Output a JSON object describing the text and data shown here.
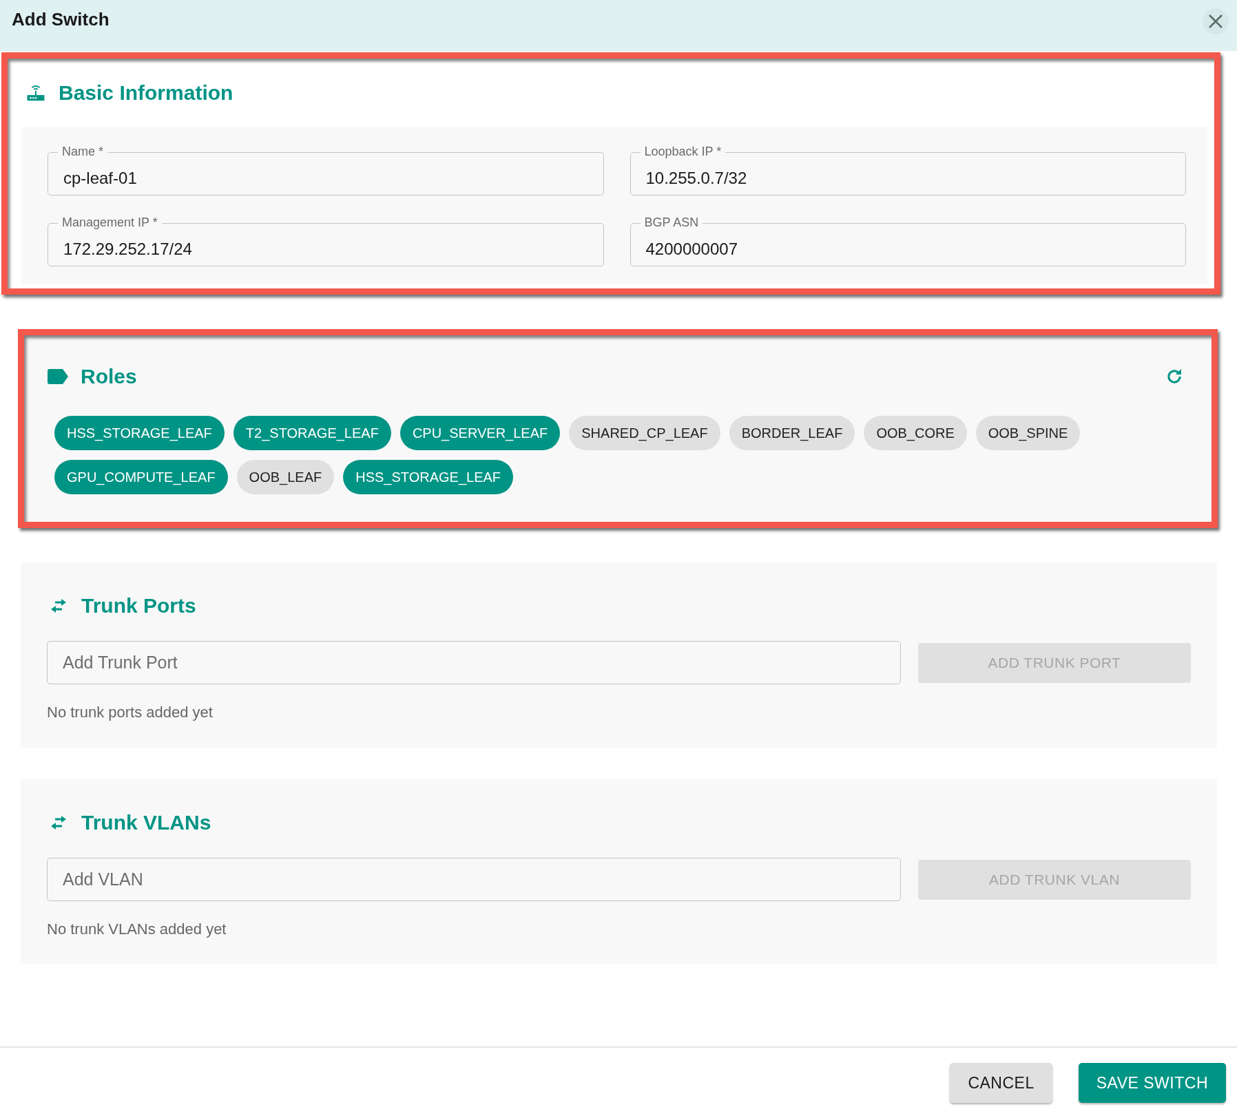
{
  "dialog": {
    "title": "Add Switch"
  },
  "basic_information": {
    "title": "Basic Information",
    "highlighted": true,
    "fields": [
      {
        "label": "Name *",
        "value": "cp-leaf-01"
      },
      {
        "label": "Loopback IP *",
        "value": "10.255.0.7/32"
      },
      {
        "label": "Management IP *",
        "value": "172.29.252.17/24"
      },
      {
        "label": "BGP ASN",
        "value": "4200000007"
      }
    ]
  },
  "roles": {
    "title": "Roles",
    "highlighted": true,
    "chips": [
      {
        "label": "HSS_STORAGE_LEAF",
        "selected": true
      },
      {
        "label": "T2_STORAGE_LEAF",
        "selected": true
      },
      {
        "label": "CPU_SERVER_LEAF",
        "selected": true
      },
      {
        "label": "SHARED_CP_LEAF",
        "selected": false
      },
      {
        "label": "BORDER_LEAF",
        "selected": false
      },
      {
        "label": "OOB_CORE",
        "selected": false
      },
      {
        "label": "OOB_SPINE",
        "selected": false
      },
      {
        "label": "GPU_COMPUTE_LEAF",
        "selected": true
      },
      {
        "label": "OOB_LEAF",
        "selected": false
      },
      {
        "label": "HSS_STORAGE_LEAF",
        "selected": true
      }
    ]
  },
  "trunk_ports": {
    "title": "Trunk Ports",
    "input": {
      "placeholder": "Add Trunk Port"
    },
    "button": {
      "label": "ADD TRUNK PORT",
      "disabled": true
    },
    "empty_message": "No trunk ports added yet"
  },
  "trunk_vlans": {
    "title": "Trunk VLANs",
    "input": {
      "placeholder": "Add VLAN"
    },
    "button": {
      "label": "ADD TRUNK VLAN",
      "disabled": true
    },
    "empty_message": "No trunk VLANs added yet"
  },
  "footer": {
    "buttons": [
      {
        "label": "CANCEL",
        "kind": "secondary"
      },
      {
        "label": "SAVE SWITCH",
        "kind": "primary"
      }
    ]
  }
}
